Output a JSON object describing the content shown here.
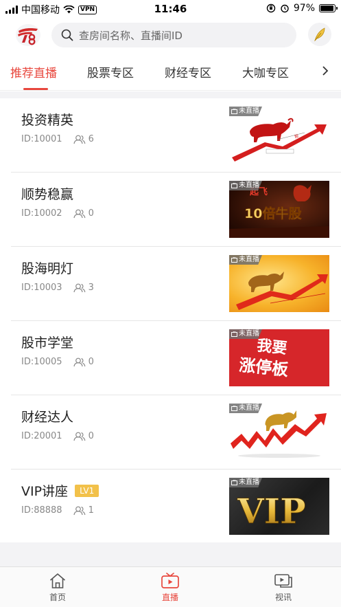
{
  "status_bar": {
    "carrier": "中国移动",
    "vpn": "VPN",
    "time": "11:46",
    "battery": "97%",
    "battery_level": 0.97
  },
  "search": {
    "placeholder": "查房间名称、直播间ID"
  },
  "tabs": [
    {
      "label": "推荐直播",
      "active": true
    },
    {
      "label": "股票专区",
      "active": false
    },
    {
      "label": "财经专区",
      "active": false
    },
    {
      "label": "大咖专区",
      "active": false
    }
  ],
  "rooms": [
    {
      "title": "投资精英",
      "id": "ID:10001",
      "viewers": "6",
      "status": "未直播",
      "badge": ""
    },
    {
      "title": "顺势稳赢",
      "id": "ID:10002",
      "viewers": "0",
      "status": "未直播",
      "badge": ""
    },
    {
      "title": "股海明灯",
      "id": "ID:10003",
      "viewers": "3",
      "status": "未直播",
      "badge": ""
    },
    {
      "title": "股市学堂",
      "id": "ID:10005",
      "viewers": "0",
      "status": "未直播",
      "badge": ""
    },
    {
      "title": "财经达人",
      "id": "ID:20001",
      "viewers": "0",
      "status": "未直播",
      "badge": ""
    },
    {
      "title": "VIP讲座",
      "id": "ID:88888",
      "viewers": "1",
      "status": "未直播",
      "badge": "LV1"
    }
  ],
  "thumb_text": {
    "t2_top": "起飞",
    "t2_main": "10倍牛股",
    "t4_line1": "我要",
    "t4_line2": "涨停板",
    "t6": "VIP"
  },
  "bottom_nav": [
    {
      "label": "首页",
      "icon": "home-icon",
      "active": false
    },
    {
      "label": "直播",
      "icon": "tv-icon",
      "active": true
    },
    {
      "label": "视讯",
      "icon": "video-chat-icon",
      "active": false
    }
  ],
  "colors": {
    "accent": "#e8473d",
    "badge": "#f2c14a"
  }
}
